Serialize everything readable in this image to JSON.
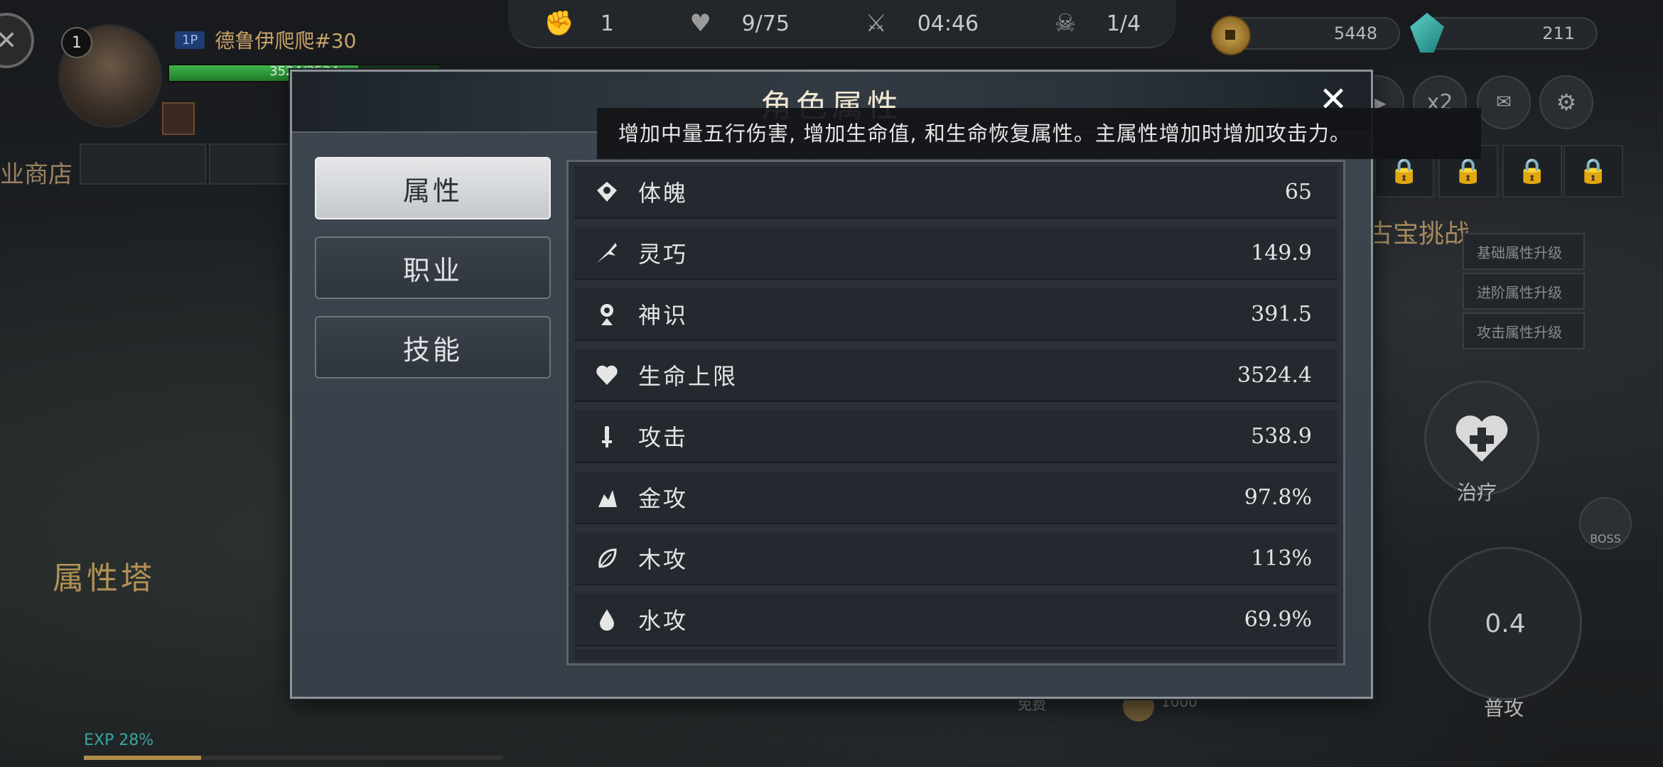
{
  "hud": {
    "kills": "1",
    "waves": "9/75",
    "timer": "04:46",
    "boss_count": "1/4",
    "coins": "5448",
    "gems": "211",
    "speed": "x2"
  },
  "player": {
    "level": "1",
    "tag": "1P",
    "name": "德鲁伊爬爬#30",
    "hp_text": "3524/3524",
    "hp_fraction": 0.7
  },
  "world": {
    "shop_label": "业商店",
    "tower_label": "属性塔",
    "treasure_label": "古宝挑战",
    "exp_label": "EXP 28%",
    "exp_fraction": 0.28,
    "bottom_cost": "1000",
    "bottom_free": "免费"
  },
  "right_hud": {
    "upgrades": [
      "基础属性升级",
      "进阶属性升级",
      "攻击属性升级"
    ],
    "heal_label": "治疗",
    "attack_label": "普攻",
    "attack_cooldown": "0.4",
    "boss_label": "BOSS"
  },
  "modal": {
    "title": "角色属性",
    "tooltip": "增加中量五行伤害, 增加生命值, 和生命恢复属性。主属性增加时增加攻击力。",
    "tabs": [
      {
        "label": "属性",
        "active": true
      },
      {
        "label": "职业",
        "active": false
      },
      {
        "label": "技能",
        "active": false
      }
    ],
    "stats": [
      {
        "name": "体魄",
        "value": "65",
        "icon": "body-icon"
      },
      {
        "name": "灵巧",
        "value": "149.9",
        "icon": "agility-icon"
      },
      {
        "name": "神识",
        "value": "391.5",
        "icon": "spirit-icon"
      },
      {
        "name": "生命上限",
        "value": "3524.4",
        "icon": "heart-icon"
      },
      {
        "name": "攻击",
        "value": "538.9",
        "icon": "sword-icon"
      },
      {
        "name": "金攻",
        "value": "97.8%",
        "icon": "metal-icon"
      },
      {
        "name": "木攻",
        "value": "113%",
        "icon": "leaf-icon"
      },
      {
        "name": "水攻",
        "value": "69.9%",
        "icon": "water-icon"
      }
    ]
  }
}
